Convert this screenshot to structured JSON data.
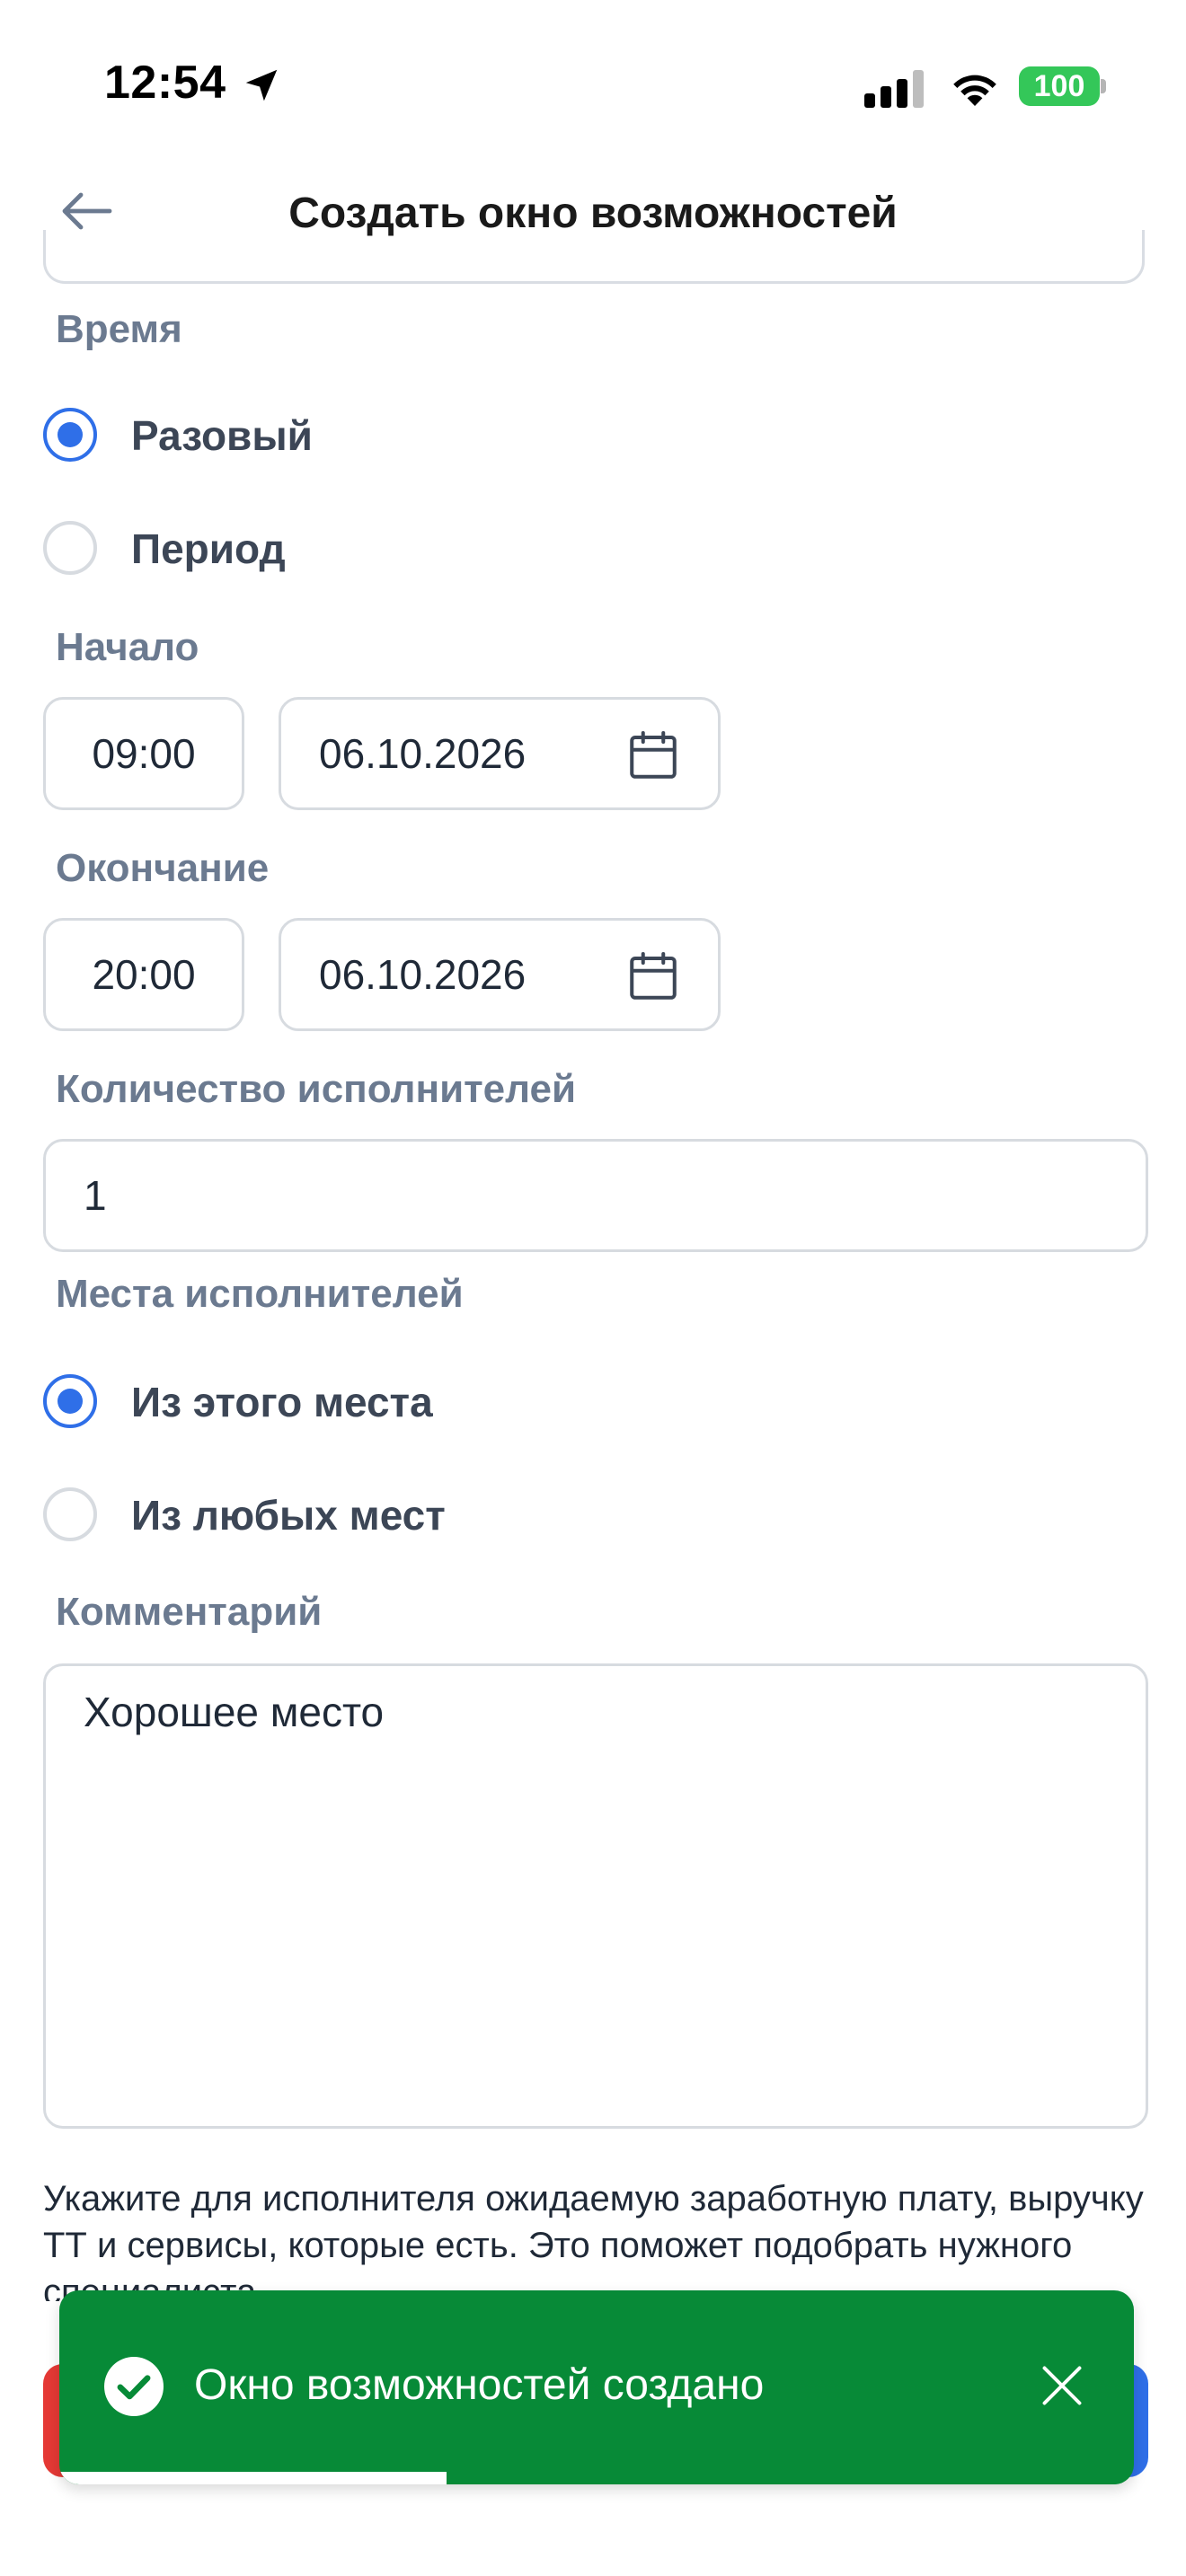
{
  "status_bar": {
    "time": "12:54",
    "battery": "100"
  },
  "header": {
    "title": "Создать окно возможностей"
  },
  "time_section": {
    "label": "Время",
    "options": [
      {
        "label": "Разовый",
        "selected": true
      },
      {
        "label": "Период",
        "selected": false
      }
    ]
  },
  "start": {
    "label": "Начало",
    "time": "09:00",
    "date": "06.10.2026"
  },
  "end": {
    "label": "Окончание",
    "time": "20:00",
    "date": "06.10.2026"
  },
  "performers_count": {
    "label": "Количество исполнителей",
    "value": "1"
  },
  "performer_places": {
    "label": "Места исполнителей",
    "options": [
      {
        "label": "Из этого места",
        "selected": true
      },
      {
        "label": "Из любых мест",
        "selected": false
      }
    ]
  },
  "comment": {
    "label": "Комментарий",
    "value": "Хорошее место"
  },
  "hint": "Укажите для исполнителя ожидаемую заработную плату, выручку ТТ и сервисы, которые есть. Это поможет подобрать нужного специалиста.",
  "toast": {
    "message": "Окно возможностей создано",
    "progress": 0.36
  },
  "colors": {
    "accent": "#2f6fe8",
    "toast_bg": "#078a37",
    "label": "#6b7a90",
    "danger": "#e53935"
  }
}
